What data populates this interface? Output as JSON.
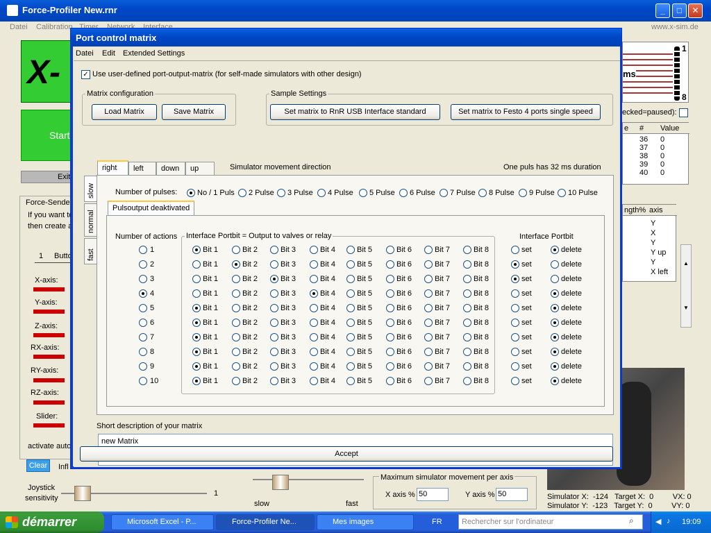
{
  "main_window": {
    "title": "Force-Profiler    New.rnr",
    "menu": [
      "Datei",
      "Calibration",
      "Timer",
      "Network",
      "Interface"
    ],
    "url": "www.x-sim.de"
  },
  "background_app": {
    "start_label": "Start",
    "exit_label": "Exit",
    "force_sender_label": "Force-Sender",
    "force_sender_text_1": "If you want to",
    "force_sender_text_2": "then create a",
    "slider_num": "1",
    "slider_label": "Butto",
    "axes": [
      "X-axis:",
      "Y-axis:",
      "Z-axis:",
      "RX-axis:",
      "RY-axis:",
      "RZ-axis:",
      "Slider:"
    ],
    "activate_auto": "activate auto",
    "clear_label": "Clear",
    "infl_label": "Infl",
    "joystick_label_1": "Joystick",
    "joystick_label_2": "sensitivity",
    "joystick_value": "1",
    "slow_label": "slow",
    "fast_label": "fast",
    "max_move_label": "Maximum simulator movement per axis",
    "x_axis_pct_label": "X axis %",
    "x_axis_pct_value": "50",
    "y_axis_pct_label": "Y axis %",
    "y_axis_pct_value": "50",
    "ms_label": "ms",
    "checked_paused": "ecked=paused):",
    "right_table_headers": [
      "e",
      "#",
      "Value"
    ],
    "right_table_rows": [
      [
        "36",
        "0"
      ],
      [
        "37",
        "0"
      ],
      [
        "38",
        "0"
      ],
      [
        "39",
        "0"
      ],
      [
        "40",
        "0"
      ]
    ],
    "axis_table_headers": [
      "ngth%",
      "axis"
    ],
    "axis_table_rows": [
      "Y",
      "X",
      "Y",
      "Y up",
      "Y",
      "X left"
    ],
    "indicator_top": "1",
    "indicator_bottom": "8",
    "sim_line_1": "Simulator X:  -124   Target X:  0         VX: 0",
    "sim_line_2": "Simulator Y:  -123   Target Y:  0         VY: 0"
  },
  "dialog": {
    "title": "Port control matrix",
    "menu": [
      "Datei",
      "Edit",
      "Extended Settings"
    ],
    "use_user_defined_label": "Use user-defined port-output-matrix  (for self-made simulators with other design)",
    "matrix_config_legend": "Matrix configuration",
    "load_matrix": "Load Matrix",
    "save_matrix": "Save Matrix",
    "sample_settings_legend": "Sample Settings",
    "set_rnr": "Set matrix to RnR USB Interface standard",
    "set_festo": "Set matrix to Festo 4 ports single speed",
    "tabs": [
      "right",
      "left",
      "down",
      "up"
    ],
    "direction_label": "Simulator movement direction",
    "puls_duration": "One puls has 32 ms duration",
    "vtabs": [
      "slow",
      "normal",
      "fast"
    ],
    "num_pulses_label": "Number of pulses:",
    "pulse_options": [
      "No / 1 Puls",
      "2 Pulse",
      "3 Pulse",
      "4 Pulse",
      "5 Pulse",
      "6 Pulse",
      "7 Pulse",
      "8 Pulse",
      "9 Pulse",
      "10 Pulse"
    ],
    "pulsoutput_tab": "Pulsoutput deaktivated",
    "num_actions_label": "Number of actions",
    "actions": [
      "1",
      "2",
      "3",
      "4",
      "5",
      "6",
      "7",
      "8",
      "9",
      "10"
    ],
    "selected_action_index": 3,
    "portbit_legend": "Interface Portbit = Output to valves or relay",
    "bits": [
      "Bit 1",
      "Bit 2",
      "Bit 3",
      "Bit 4",
      "Bit 5",
      "Bit 6",
      "Bit 7",
      "Bit 8"
    ],
    "bit_selection": [
      1,
      2,
      3,
      4,
      1,
      1,
      1,
      1,
      1,
      1
    ],
    "setdel_legend": "Interface Portbit",
    "set_label": "set",
    "delete_label": "delete",
    "setdel_selection": [
      "delete",
      "set",
      "set",
      "delete",
      "delete",
      "delete",
      "delete",
      "delete",
      "delete",
      "delete"
    ],
    "short_desc_label": "Short description of your matrix",
    "short_desc_value": "new Matrix",
    "accept": "Accept"
  },
  "taskbar": {
    "start": "démarrer",
    "tasks": [
      "Microsoft Excel - P...",
      "Force-Profiler    Ne...",
      "Mes images"
    ],
    "lang": "FR",
    "search_placeholder": "Rechercher sur l'ordinateur",
    "clock": "19:09"
  }
}
